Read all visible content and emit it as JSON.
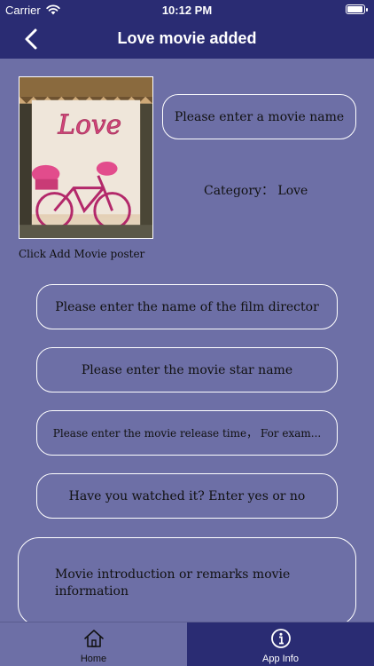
{
  "status_bar": {
    "carrier": "Carrier",
    "time": "10:12 PM"
  },
  "nav": {
    "title": "Love movie added",
    "back_icon": "chevron-left-icon"
  },
  "form": {
    "poster_caption": "Click Add Movie poster",
    "movie_name_placeholder": "Please enter a movie name",
    "category": "Category： Love",
    "director_placeholder": "Please enter the name of the film director",
    "star_placeholder": "Please enter the movie star name",
    "release_placeholder": "Please enter the movie release time， For exam...",
    "watched_placeholder": "Have you watched it? Enter yes or no",
    "intro_placeholder": "Movie introduction or remarks movie information",
    "poster_sign_text": "Love"
  },
  "tab_bar": {
    "items": [
      {
        "label": "Home",
        "icon": "home-icon"
      },
      {
        "label": "App Info",
        "icon": "info-icon"
      }
    ]
  },
  "colors": {
    "nav_background": "#2a2c73",
    "page_background": "#6d6fa6",
    "field_border": "#ffffff",
    "active_tab": "#2a2c73"
  }
}
